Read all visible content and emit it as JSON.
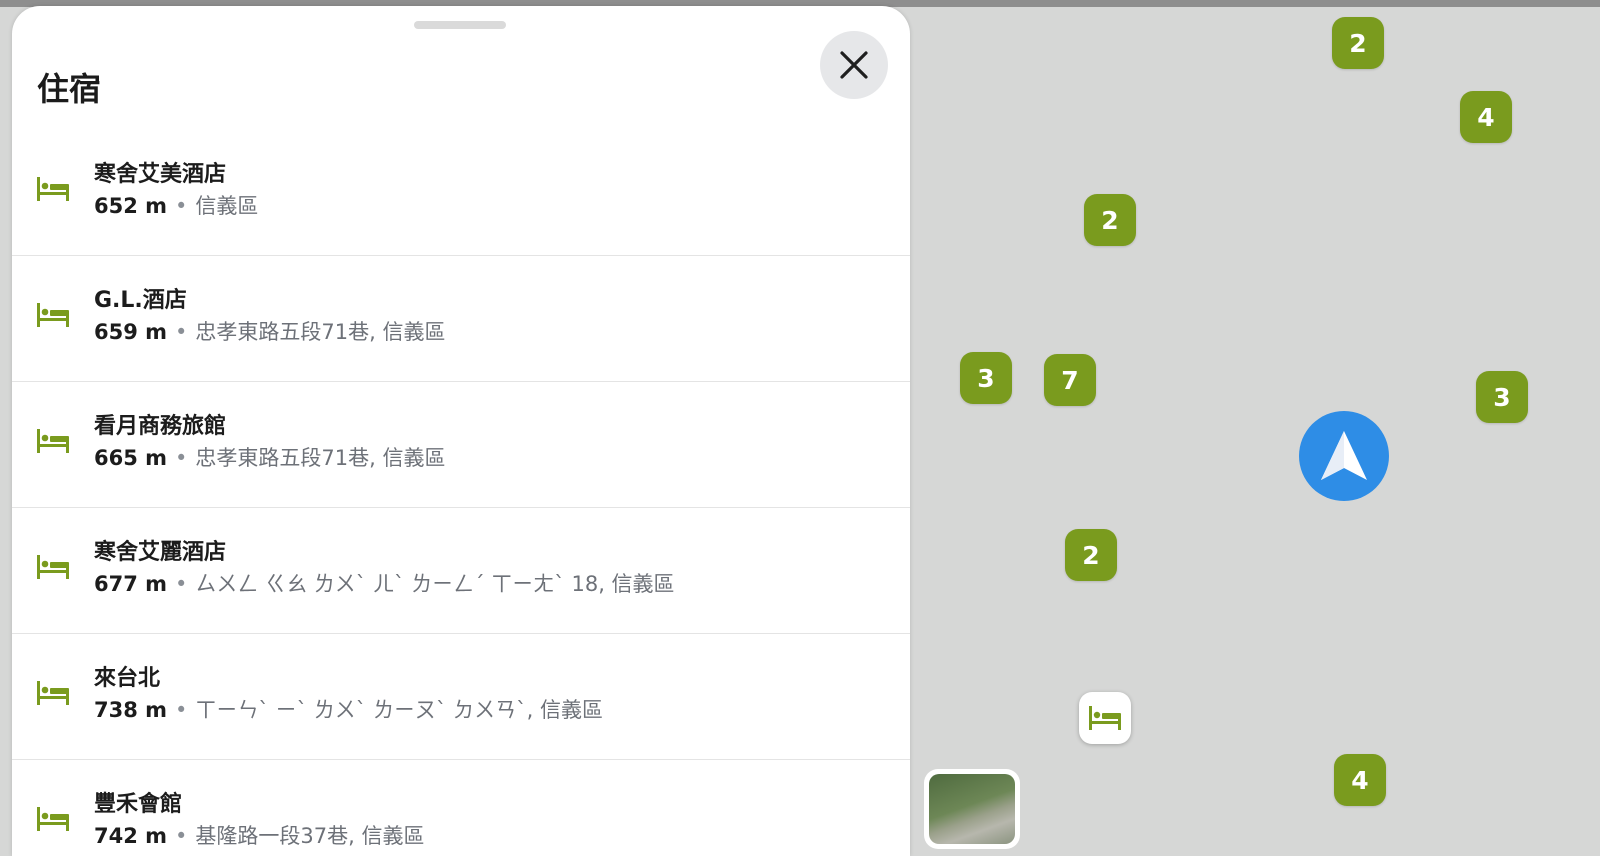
{
  "sheet": {
    "title": "住宿",
    "items": [
      {
        "name": "寒舍艾美酒店",
        "distance": "652 m",
        "address": "信義區"
      },
      {
        "name": "G.L.酒店",
        "distance": "659 m",
        "address": "忠孝東路五段71巷, 信義區"
      },
      {
        "name": "看月商務旅館",
        "distance": "665 m",
        "address": "忠孝東路五段71巷, 信義區"
      },
      {
        "name": "寒舍艾麗酒店",
        "distance": "677 m",
        "address": "ㄙㄨㄥ ㄍㄠ ㄌㄨˋ ㄦˋ ㄌㄧㄥˊ ㄒㄧㄤˋ 18, 信義區"
      },
      {
        "name": "來台北",
        "distance": "738 m",
        "address": "ㄒㄧㄣˋ ㄧˋ ㄌㄨˋ ㄌㄧㄡˋ ㄉㄨㄢˋ, 信義區"
      },
      {
        "name": "豐禾會館",
        "distance": "742 m",
        "address": "基隆路一段37巷, 信義區"
      }
    ],
    "separator": "•"
  },
  "map": {
    "clusters": [
      "2",
      "4",
      "2",
      "3",
      "7",
      "3",
      "2",
      "4"
    ]
  },
  "colors": {
    "accent": "#7a9b1e",
    "locator": "#2e8de6",
    "map_bg": "#d6d7d6"
  },
  "icons": {
    "close": "close-icon",
    "list_item": "bed-icon",
    "locator": "navigation-arrow-icon"
  }
}
